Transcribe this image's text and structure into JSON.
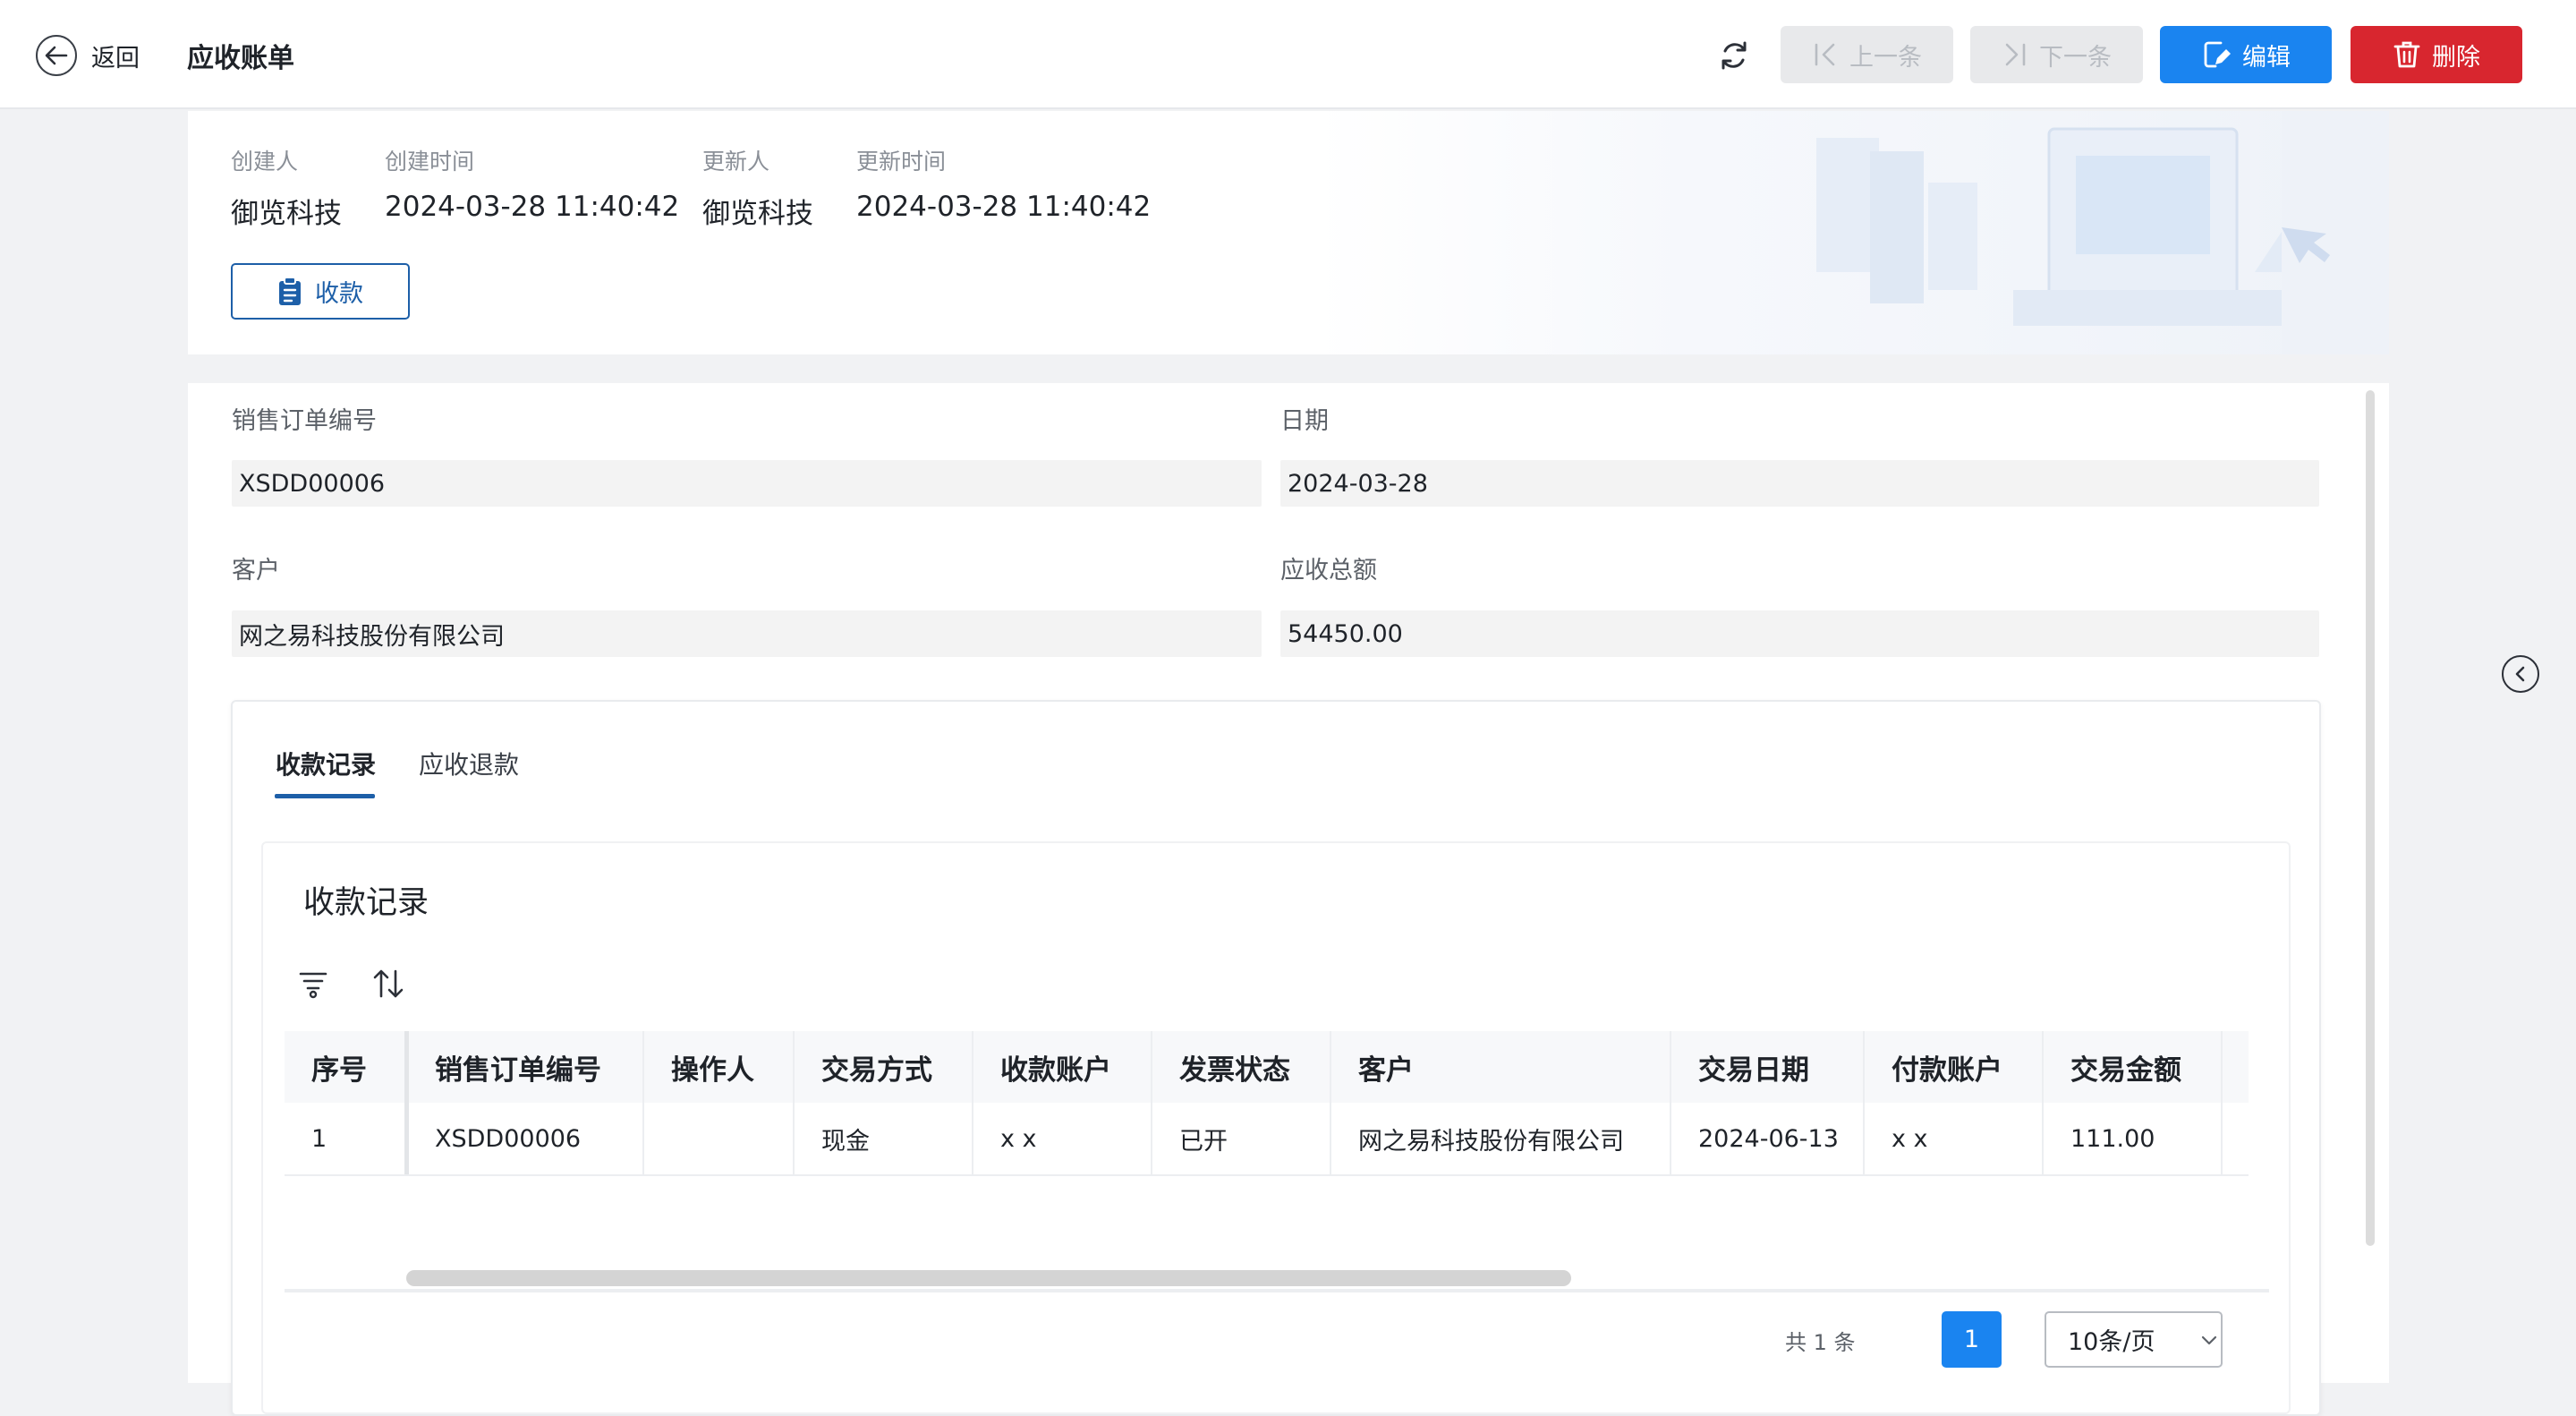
{
  "header": {
    "back_label": "返回",
    "title": "应收账单",
    "prev_label": "上一条",
    "next_label": "下一条",
    "edit_label": "编辑",
    "delete_label": "删除",
    "colors": {
      "primary": "#1a84f0",
      "danger": "#d8262f",
      "disabled_bg": "#e8e9eb"
    }
  },
  "meta": {
    "creator_label": "创建人",
    "creator": "御览科技",
    "created_label": "创建时间",
    "created": "2024-03-28 11:40:42",
    "updater_label": "更新人",
    "updater": "御览科技",
    "updated_label": "更新时间",
    "updated": "2024-03-28 11:40:42",
    "collect_label": "收款"
  },
  "form": {
    "order_no_label": "销售订单编号",
    "order_no": "XSDD00006",
    "date_label": "日期",
    "date": "2024-03-28",
    "customer_label": "客户",
    "customer": "网之易科技股份有限公司",
    "total_label": "应收总额",
    "total": "54450.00"
  },
  "tabs": [
    {
      "label": "收款记录",
      "active": true
    },
    {
      "label": "应收退款",
      "active": false
    }
  ],
  "section_title": "收款记录",
  "table": {
    "columns": [
      "序号",
      "销售订单编号",
      "操作人",
      "交易方式",
      "收款账户",
      "发票状态",
      "客户",
      "交易日期",
      "付款账户",
      "交易金额"
    ],
    "rows": [
      [
        "1",
        "XSDD00006",
        "",
        "现金",
        "x x",
        "已开",
        "网之易科技股份有限公司",
        "2024-06-13",
        "x x",
        "111.00"
      ]
    ]
  },
  "pagination": {
    "total_text": "共 1 条",
    "current_page": "1",
    "page_size": "10条/页"
  }
}
